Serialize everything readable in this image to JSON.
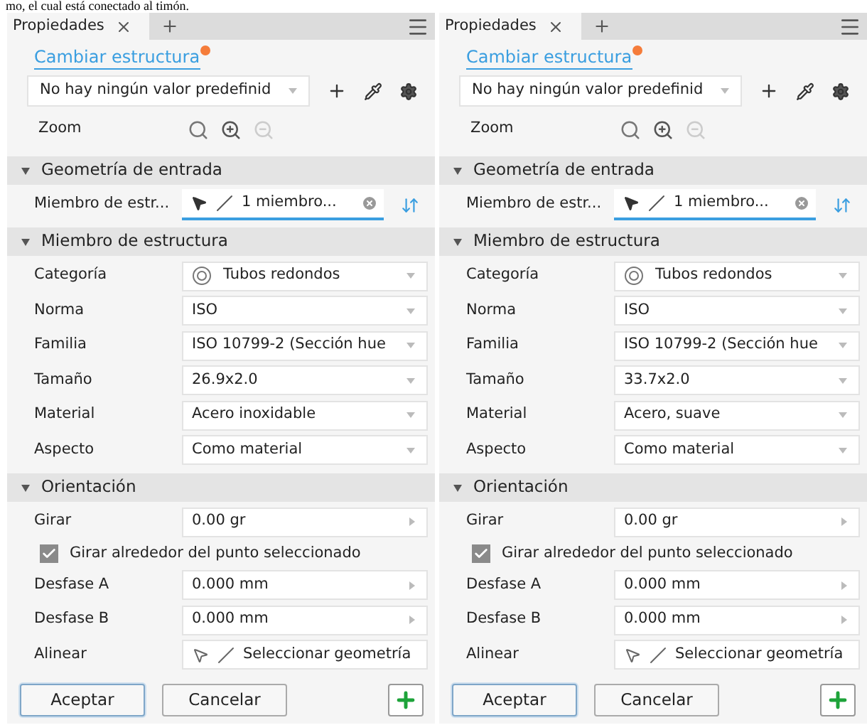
{
  "caption": "mo, el cual está conectado al timón.",
  "panels": [
    {
      "tab": {
        "label": "Propiedades",
        "selected": true
      },
      "link": "Cambiar estructura",
      "preset": "No hay ningún valor predefinid",
      "zoom_label": "Zoom",
      "sections": [
        {
          "title": "Geometría de entrada",
          "expanded": true,
          "fields": [
            {
              "kind": "pick",
              "label": "Miembro de estr...",
              "value": "1 miembro..."
            }
          ]
        },
        {
          "title": "Miembro de estructura",
          "expanded": true,
          "fields": [
            {
              "kind": "dropdown",
              "label": "Categoría",
              "value": "Tubos redondos",
              "ring": true
            },
            {
              "kind": "dropdown",
              "label": "Norma",
              "value": "ISO"
            },
            {
              "kind": "dropdown",
              "label": "Familia",
              "value": "ISO 10799-2 (Sección hue"
            },
            {
              "kind": "dropdown",
              "label": "Tamaño",
              "value": "26.9x2.0"
            },
            {
              "kind": "dropdown",
              "label": "Material",
              "value": "Acero inoxidable"
            },
            {
              "kind": "dropdown",
              "label": "Aspecto",
              "value": "Como material"
            }
          ]
        },
        {
          "title": "Orientación",
          "expanded": true,
          "fields": [
            {
              "kind": "spinner",
              "label": "Girar",
              "value": "0.00 gr"
            },
            {
              "kind": "checkbox",
              "label": "Girar alrededor del punto seleccionado",
              "checked": true
            },
            {
              "kind": "spinner",
              "label": "Desfase A",
              "value": "0.000 mm"
            },
            {
              "kind": "spinner",
              "label": "Desfase B",
              "value": "0.000 mm"
            },
            {
              "kind": "select",
              "label": "Alinear",
              "value": "Seleccionar geometría"
            }
          ]
        }
      ],
      "buttons": [
        "Aceptar",
        "Cancelar"
      ]
    },
    {
      "tab": {
        "label": "Propiedades",
        "selected": true
      },
      "link": "Cambiar estructura",
      "preset": "No hay ningún valor predefinid",
      "zoom_label": "Zoom",
      "sections": [
        {
          "title": "Geometría de entrada",
          "expanded": true,
          "fields": [
            {
              "kind": "pick",
              "label": "Miembro de estr...",
              "value": "1 miembro..."
            }
          ]
        },
        {
          "title": "Miembro de estructura",
          "expanded": true,
          "fields": [
            {
              "kind": "dropdown",
              "label": "Categoría",
              "value": "Tubos redondos",
              "ring": true
            },
            {
              "kind": "dropdown",
              "label": "Norma",
              "value": "ISO"
            },
            {
              "kind": "dropdown",
              "label": "Familia",
              "value": "ISO 10799-2 (Sección hue"
            },
            {
              "kind": "dropdown",
              "label": "Tamaño",
              "value": "33.7x2.0"
            },
            {
              "kind": "dropdown",
              "label": "Material",
              "value": "Acero, suave"
            },
            {
              "kind": "dropdown",
              "label": "Aspecto",
              "value": "Como material"
            }
          ]
        },
        {
          "title": "Orientación",
          "expanded": true,
          "fields": [
            {
              "kind": "spinner",
              "label": "Girar",
              "value": "0.00 gr"
            },
            {
              "kind": "checkbox",
              "label": "Girar alrededor del punto seleccionado",
              "checked": true
            },
            {
              "kind": "spinner",
              "label": "Desfase A",
              "value": "0.000 mm"
            },
            {
              "kind": "spinner",
              "label": "Desfase B",
              "value": "0.000 mm"
            },
            {
              "kind": "select",
              "label": "Alinear",
              "value": "Seleccionar geometría"
            }
          ]
        }
      ],
      "buttons": [
        "Aceptar",
        "Cancelar"
      ]
    }
  ]
}
